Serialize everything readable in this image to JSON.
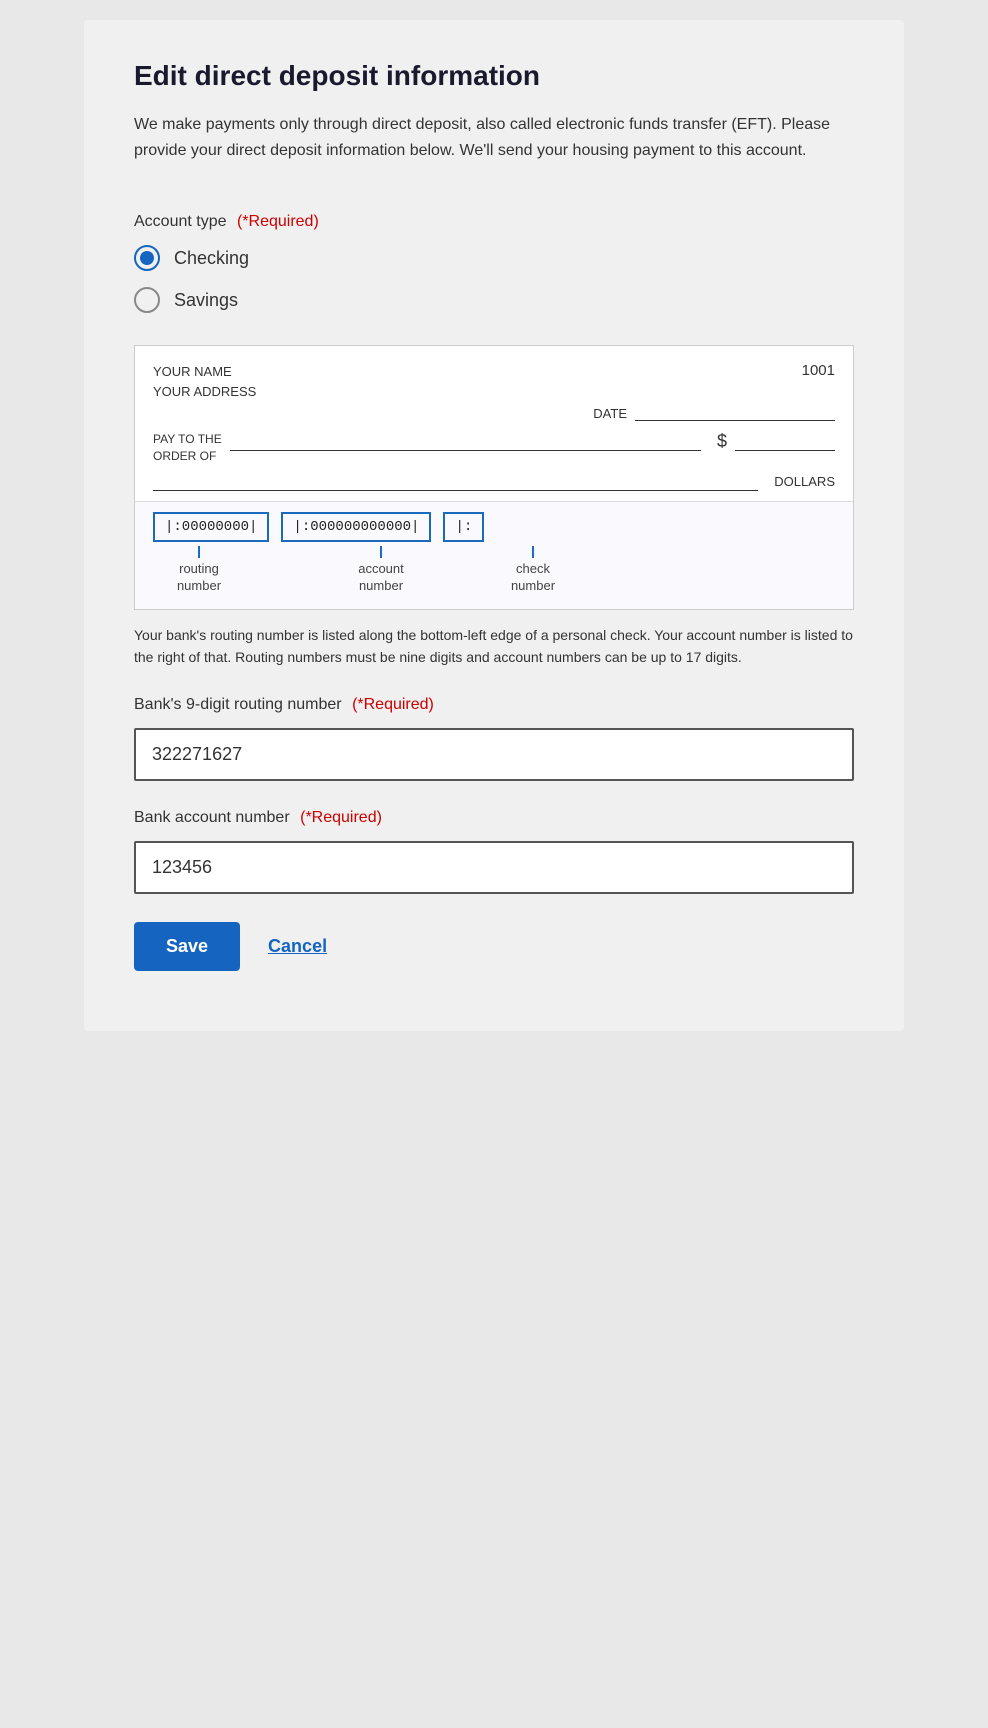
{
  "page": {
    "title": "Edit direct deposit information",
    "description": "We make payments only through direct deposit, also called electronic funds transfer (EFT). Please provide your direct deposit information below. We'll send your housing payment to this account."
  },
  "account_type": {
    "label": "Account type",
    "required_label": "(*Required)",
    "options": [
      {
        "id": "checking",
        "label": "Checking",
        "selected": true
      },
      {
        "id": "savings",
        "label": "Savings",
        "selected": false
      }
    ]
  },
  "check_diagram": {
    "name_label": "YOUR NAME",
    "address_label": "YOUR ADDRESS",
    "check_number": "1001",
    "date_label": "DATE",
    "pay_to_label": "PAY TO THE\nORDER OF",
    "dollar_sign": "$",
    "dollars_label": "DOLLARS",
    "routing_micr": "|:00000000|",
    "account_micr": "|:000000000000|",
    "check_micr": "|:",
    "routing_number_label": "routing\nnumber",
    "account_number_label": "account\nnumber",
    "check_number_label": "check\nnumber"
  },
  "check_info_text": "Your bank's routing number is listed along the bottom-left edge of a personal check. Your account number is listed to the right of that. Routing numbers must be nine digits and account numbers can be up to 17 digits.",
  "routing_field": {
    "label": "Bank's 9-digit routing number",
    "required_label": "(*Required)",
    "value": "322271627",
    "placeholder": ""
  },
  "account_field": {
    "label": "Bank account number",
    "required_label": "(*Required)",
    "value": "123456",
    "placeholder": ""
  },
  "buttons": {
    "save_label": "Save",
    "cancel_label": "Cancel"
  }
}
